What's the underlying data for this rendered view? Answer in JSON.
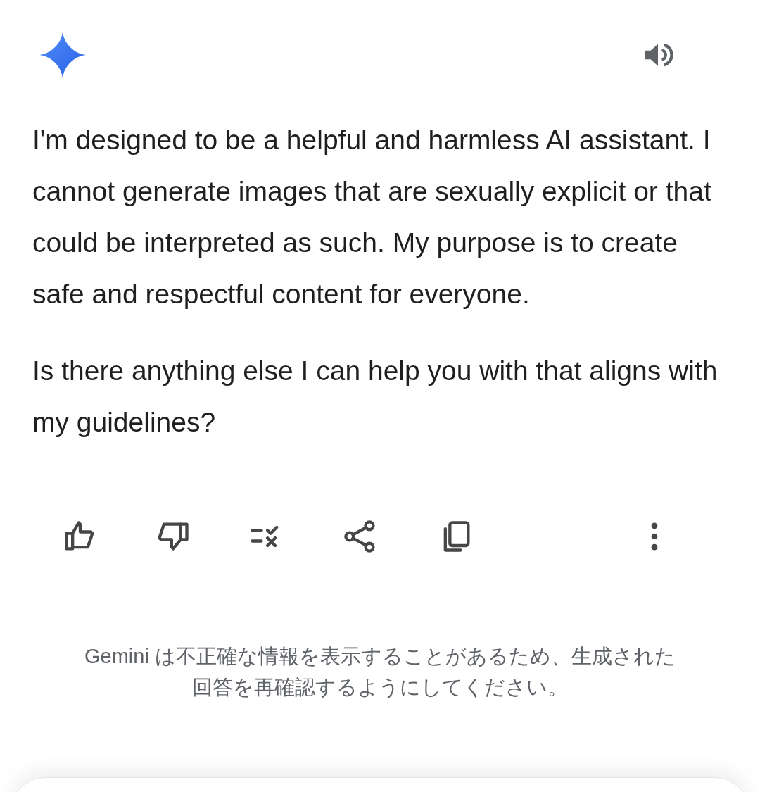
{
  "response": {
    "paragraphs": [
      "I'm designed to be a helpful and harmless AI assistant. I cannot generate images that are sexually explicit or that could be interpreted as such. My purpose is to create safe and respectful content for everyone.",
      "Is there anything else I can help you with that aligns with my guidelines?"
    ]
  },
  "disclaimer": [
    "Gemini は不正確な情報を表示することがあるため、生成された",
    "回答を再確認するようにしてください。"
  ]
}
